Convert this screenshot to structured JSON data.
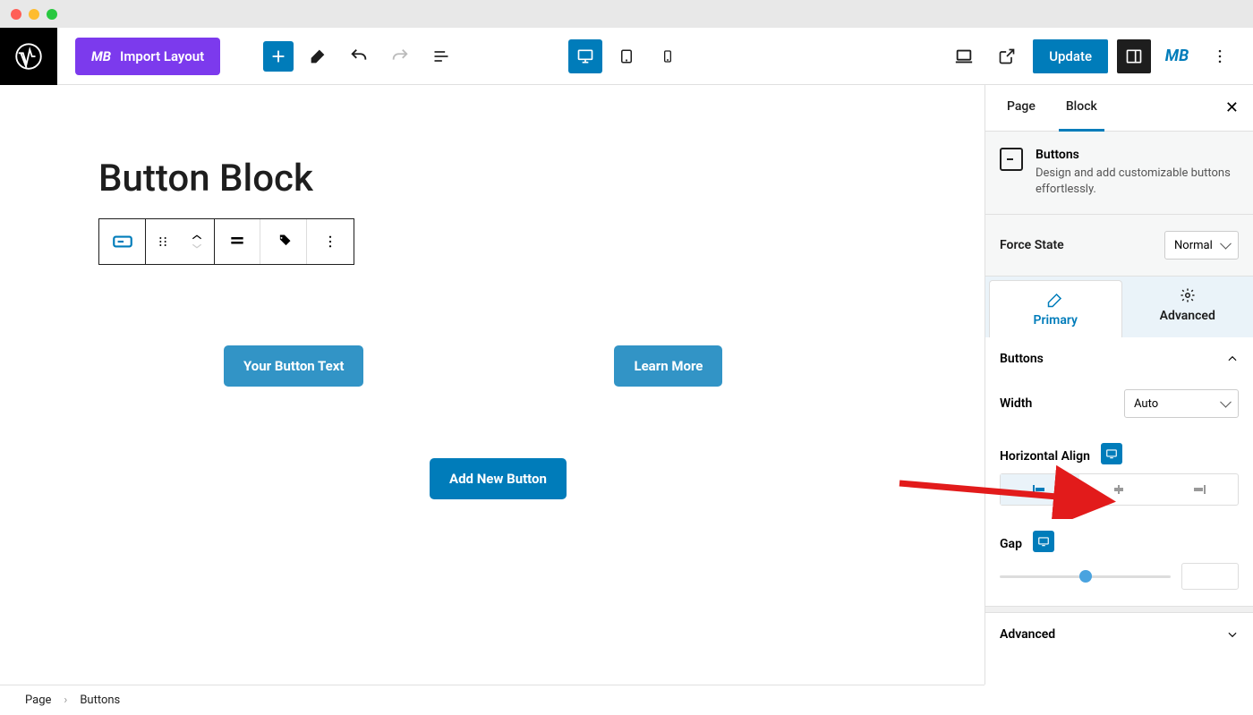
{
  "header": {
    "import_label": "Import Layout",
    "update_label": "Update"
  },
  "canvas": {
    "title": "Button Block",
    "button1": "Your Button Text",
    "button2": "Learn More",
    "add_button": "Add New Button"
  },
  "sidebar": {
    "tab_page": "Page",
    "tab_block": "Block",
    "block_name": "Buttons",
    "block_desc": "Design and add customizable buttons effortlessly.",
    "force_state_label": "Force State",
    "force_state_value": "Normal",
    "mode_primary": "Primary",
    "mode_advanced": "Advanced",
    "section_buttons": "Buttons",
    "width_label": "Width",
    "width_value": "Auto",
    "halign_label": "Horizontal Align",
    "gap_label": "Gap",
    "section_advanced": "Advanced"
  },
  "breadcrumb": {
    "root": "Page",
    "current": "Buttons"
  }
}
